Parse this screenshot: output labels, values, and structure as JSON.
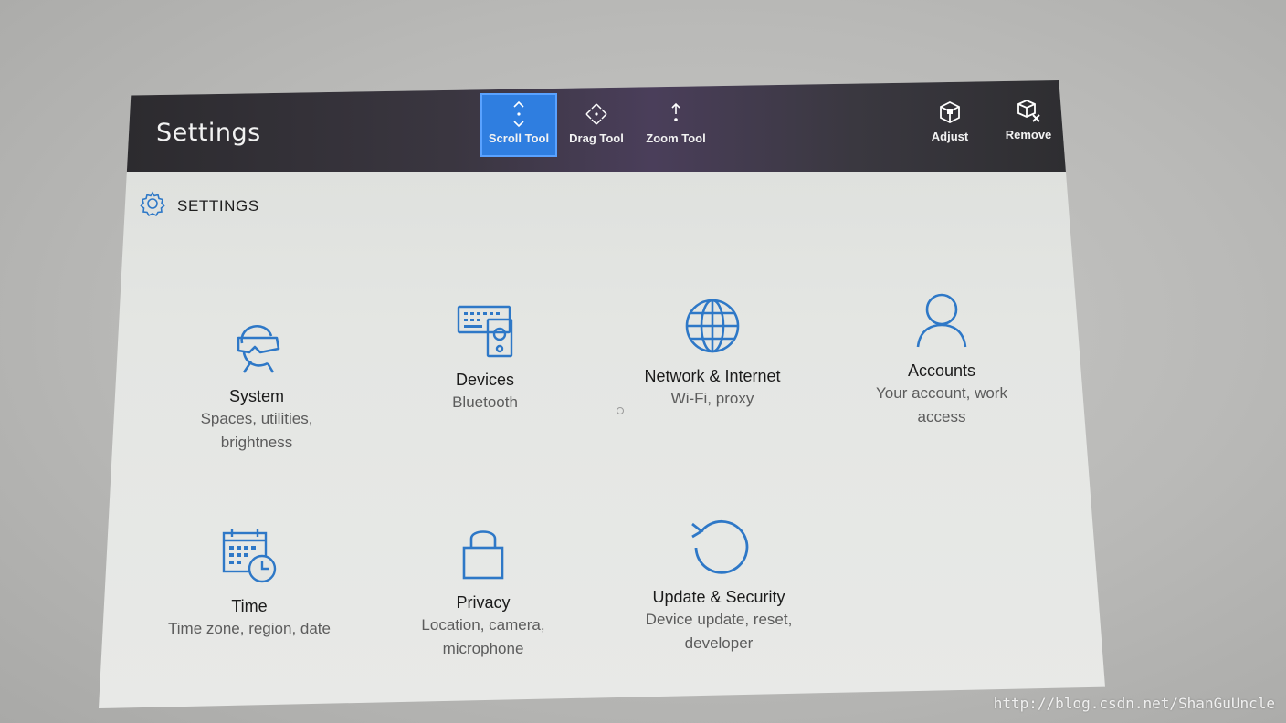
{
  "window": {
    "title": "Settings"
  },
  "toolbar": {
    "tools": [
      {
        "label": "Scroll Tool",
        "icon": "scroll-arrows-icon",
        "active": true
      },
      {
        "label": "Drag Tool",
        "icon": "drag-move-icon",
        "active": false
      },
      {
        "label": "Zoom Tool",
        "icon": "zoom-arrows-icon",
        "active": false
      }
    ],
    "actions": [
      {
        "label": "Adjust",
        "icon": "adjust-cube-icon"
      },
      {
        "label": "Remove",
        "icon": "remove-cube-icon"
      }
    ]
  },
  "section": {
    "title": "SETTINGS",
    "icon": "gear-icon"
  },
  "tiles": [
    {
      "name": "System",
      "desc": [
        "Spaces, utilities,",
        "brightness"
      ],
      "icon": "headset-person-icon"
    },
    {
      "name": "Devices",
      "desc": [
        "Bluetooth"
      ],
      "icon": "keyboard-speaker-icon"
    },
    {
      "name": "Network & Internet",
      "desc": [
        "Wi-Fi, proxy"
      ],
      "icon": "globe-icon"
    },
    {
      "name": "Accounts",
      "desc": [
        "Your account, work",
        "access"
      ],
      "icon": "person-icon"
    },
    {
      "name": "Time",
      "desc": [
        "Time zone, region, date"
      ],
      "icon": "calendar-clock-icon"
    },
    {
      "name": "Privacy",
      "desc": [
        "Location, camera,",
        "microphone"
      ],
      "icon": "lock-icon"
    },
    {
      "name": "Update & Security",
      "desc": [
        "Device update, reset,",
        "developer"
      ],
      "icon": "refresh-icon"
    }
  ],
  "watermark": "http://blog.csdn.net/ShanGuUncle",
  "colors": {
    "accent": "#2f7ee0",
    "icon_blue": "#2e78c7",
    "titlebar": "#2b2a2d"
  }
}
